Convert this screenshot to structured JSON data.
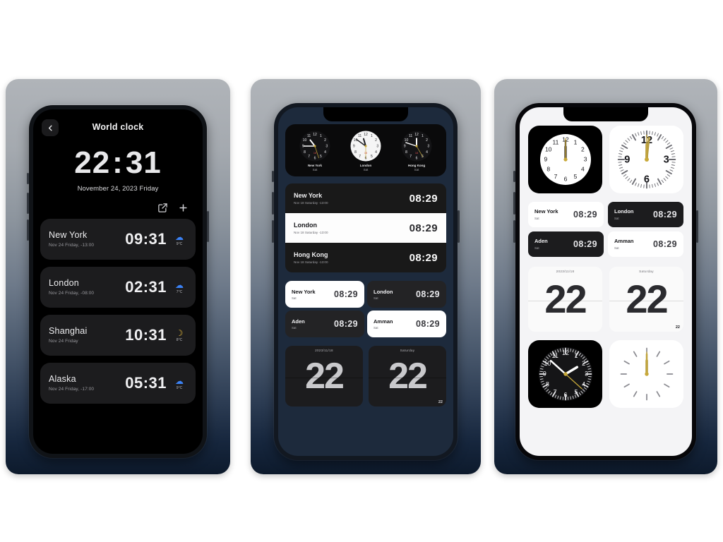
{
  "page": {
    "background": "#ffffff",
    "accent_blue": "#3b82f6",
    "accent_gold": "#c8a93a",
    "card_gradient_top": "#b0b4b9",
    "card_gradient_bottom": "#0d1a2c"
  },
  "phone1": {
    "back_icon": "chevron-left-icon",
    "title": "World clock",
    "big_time": "22",
    "big_time_colon": ":",
    "big_time_minutes": "31",
    "date": "November 24, 2023 Friday",
    "edit_icon": "edit-square-icon",
    "add_icon": "plus-icon",
    "cities": [
      {
        "name": "New York",
        "sub": "Nov 24 Friday, -13:00",
        "time": "09:31",
        "weather_icon": "cloud-icon",
        "weather_color": "#3b82f6",
        "temp": "9°C"
      },
      {
        "name": "London",
        "sub": "Nov 24 Friday, -08:00",
        "time": "02:31",
        "weather_icon": "cloud-icon",
        "weather_color": "#3b82f6",
        "temp": "7°C"
      },
      {
        "name": "Shanghai",
        "sub": "Nov 24 Friday",
        "time": "10:31",
        "weather_icon": "moon-icon",
        "weather_color": "#e0b63a",
        "temp": "8°C"
      },
      {
        "name": "Alaska",
        "sub": "Nov 24 Friday, -17:00",
        "time": "05:31",
        "weather_icon": "cloud-icon",
        "weather_color": "#3b82f6",
        "temp": "9°C"
      }
    ]
  },
  "phone2": {
    "analog_clocks": [
      {
        "city": "New York",
        "day": "Sat",
        "theme": "dark",
        "hour": 10.0,
        "minute": 45,
        "second": 27
      },
      {
        "city": "London",
        "day": "Sat",
        "theme": "light",
        "hour": 10.6,
        "minute": 51,
        "second": 30
      },
      {
        "city": "Hong Kong",
        "day": "Sat",
        "theme": "dark",
        "hour": 11.2,
        "minute": 48,
        "second": 25
      }
    ],
    "list_rows": [
      {
        "city": "New York",
        "sub": "Nov 18 Saturday -13:00",
        "time": "08:29",
        "theme": "dark"
      },
      {
        "city": "London",
        "sub": "Nov 18 Saturday -13:00",
        "time": "08:29",
        "theme": "light"
      },
      {
        "city": "Hong Kong",
        "sub": "Nov 18 Saturday -13:00",
        "time": "08:29",
        "theme": "dark"
      }
    ],
    "mini_cards": [
      {
        "city": "New York",
        "sub": "Sat",
        "time": "08:29",
        "theme": "light"
      },
      {
        "city": "London",
        "sub": "Sat",
        "time": "08:29",
        "theme": "dark"
      },
      {
        "city": "Aden",
        "sub": "Sat",
        "time": "08:29",
        "theme": "dark"
      },
      {
        "city": "Amman",
        "sub": "Sat",
        "time": "08:29",
        "theme": "light"
      }
    ],
    "flip_cards": [
      {
        "label": "2023/11/18",
        "digits": "22",
        "corner": "",
        "theme": "dark"
      },
      {
        "label": "Saturday",
        "digits": "22",
        "corner": "22",
        "theme": "dark"
      }
    ]
  },
  "phone3": {
    "top_widgets": [
      {
        "style": "numerals-dark",
        "hour": 12.0,
        "minute": 0,
        "second": 0
      },
      {
        "style": "ticks-light",
        "hour": 12.0,
        "minute": 1,
        "second": 0
      }
    ],
    "mini_cards": [
      {
        "city": "New York",
        "sub": "Sat",
        "time": "08:29",
        "theme": "light"
      },
      {
        "city": "London",
        "sub": "Sat",
        "time": "08:29",
        "theme": "dark"
      },
      {
        "city": "Aden",
        "sub": "Sat",
        "time": "08:29",
        "theme": "dark"
      },
      {
        "city": "Amman",
        "sub": "Sat",
        "time": "08:29",
        "theme": "light"
      }
    ],
    "flip_cards": [
      {
        "label": "2023/11/18",
        "digits": "22",
        "corner": ""
      },
      {
        "label": "Saturday",
        "digits": "22",
        "corner": "22"
      }
    ],
    "bottom_widgets": [
      {
        "style": "numerals-black",
        "hour": 1.1,
        "minute": 52,
        "second": 22
      },
      {
        "style": "ticks-white",
        "hour": 12.0,
        "minute": 0,
        "second": 0
      }
    ]
  }
}
